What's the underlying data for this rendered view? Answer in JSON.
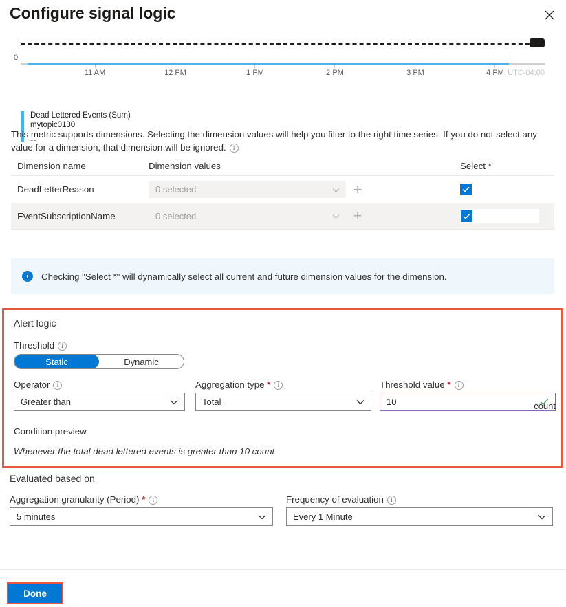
{
  "header": {
    "title": "Configure signal logic",
    "close_icon": "close-icon"
  },
  "chart": {
    "legend": {
      "metric": "Dead Lettered Events (Sum)",
      "resource": "mytopic0130",
      "value": "--"
    },
    "timezone": "UTC-04:00",
    "y_zero_label": "0"
  },
  "chart_data": {
    "type": "line",
    "title": "Dead Lettered Events (Sum)",
    "subtitle": "mytopic0130",
    "xlabel": "",
    "ylabel": "",
    "x": [
      "11 AM",
      "12 PM",
      "1 PM",
      "2 PM",
      "3 PM",
      "4 PM"
    ],
    "tick_labels": [
      "11 AM",
      "12 PM",
      "1 PM",
      "2 PM",
      "3 PM",
      "4 PM"
    ],
    "series": [
      {
        "name": "Dead Lettered Events (Sum)",
        "values": [
          0,
          0,
          0,
          0,
          0,
          0
        ],
        "color": "#4db2e8"
      }
    ],
    "threshold_line": {
      "value": 10,
      "style": "dashed",
      "color": "#201f1e",
      "label": ""
    },
    "ylim": [
      0,
      12
    ],
    "grid": false,
    "legend_position": "bottom-left",
    "current_value": "--",
    "timezone": "UTC-04:00"
  },
  "description": {
    "text": "This metric supports dimensions. Selecting the dimension values will help you filter to the right time series. If you do not select any value for a dimension, that dimension will be ignored.",
    "info_icon": "info-icon"
  },
  "dimensions_table": {
    "columns": [
      "Dimension name",
      "Dimension values",
      "Select *"
    ],
    "rows": [
      {
        "name": "DeadLetterReason",
        "values_placeholder": "0 selected",
        "add_icon": "plus-icon",
        "selected": true
      },
      {
        "name": "EventSubscriptionName",
        "values_placeholder": "0 selected",
        "add_icon": "plus-icon",
        "selected": true
      }
    ]
  },
  "banner": {
    "icon": "info-icon",
    "text": "Checking \"Select *\" will dynamically select all current and future dimension values for the dimension.",
    "background": "#eff6fc",
    "icon_color": "#0078d4"
  },
  "alert_logic": {
    "section_title": "Alert logic",
    "highlight_color": "#e8573f",
    "threshold": {
      "label": "Threshold",
      "options": [
        "Static",
        "Dynamic"
      ],
      "selected": "Static"
    },
    "operator": {
      "label": "Operator",
      "value": "Greater than"
    },
    "aggregation_type": {
      "label": "Aggregation type",
      "required": "*",
      "value": "Total"
    },
    "threshold_value": {
      "label": "Threshold value",
      "required": "*",
      "value": "10",
      "unit": "count",
      "valid_icon": "checkmark-icon",
      "border_color": "#8764b8"
    },
    "condition_preview": {
      "label": "Condition preview",
      "text": "Whenever the total dead lettered events is greater than 10 count"
    }
  },
  "evaluated_based_on": {
    "section_title": "Evaluated based on",
    "granularity": {
      "label": "Aggregation granularity (Period)",
      "required": "*",
      "value": "5 minutes"
    },
    "frequency": {
      "label": "Frequency of evaluation",
      "value": "Every 1 Minute"
    }
  },
  "footer": {
    "done_label": "Done",
    "done_color": "#0078d4",
    "highlight_color": "#e8573f"
  }
}
